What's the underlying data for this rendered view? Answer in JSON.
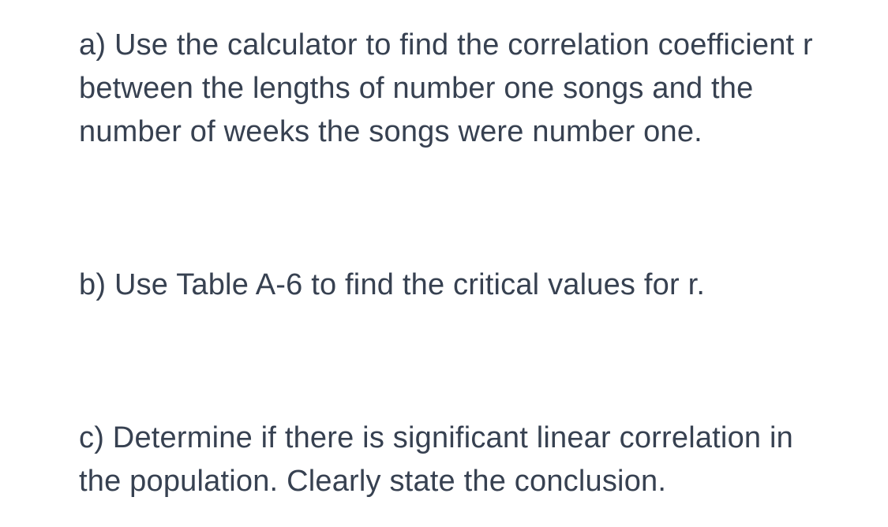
{
  "questions": {
    "part_a": "a) Use the calculator to find the correlation coefficient r between the lengths of number one songs and the number of weeks the songs were number one.",
    "part_b": "b) Use Table A-6 to find the critical values for r.",
    "part_c": "c) Determine if there is significant linear correlation in the population. Clearly state the conclusion."
  }
}
